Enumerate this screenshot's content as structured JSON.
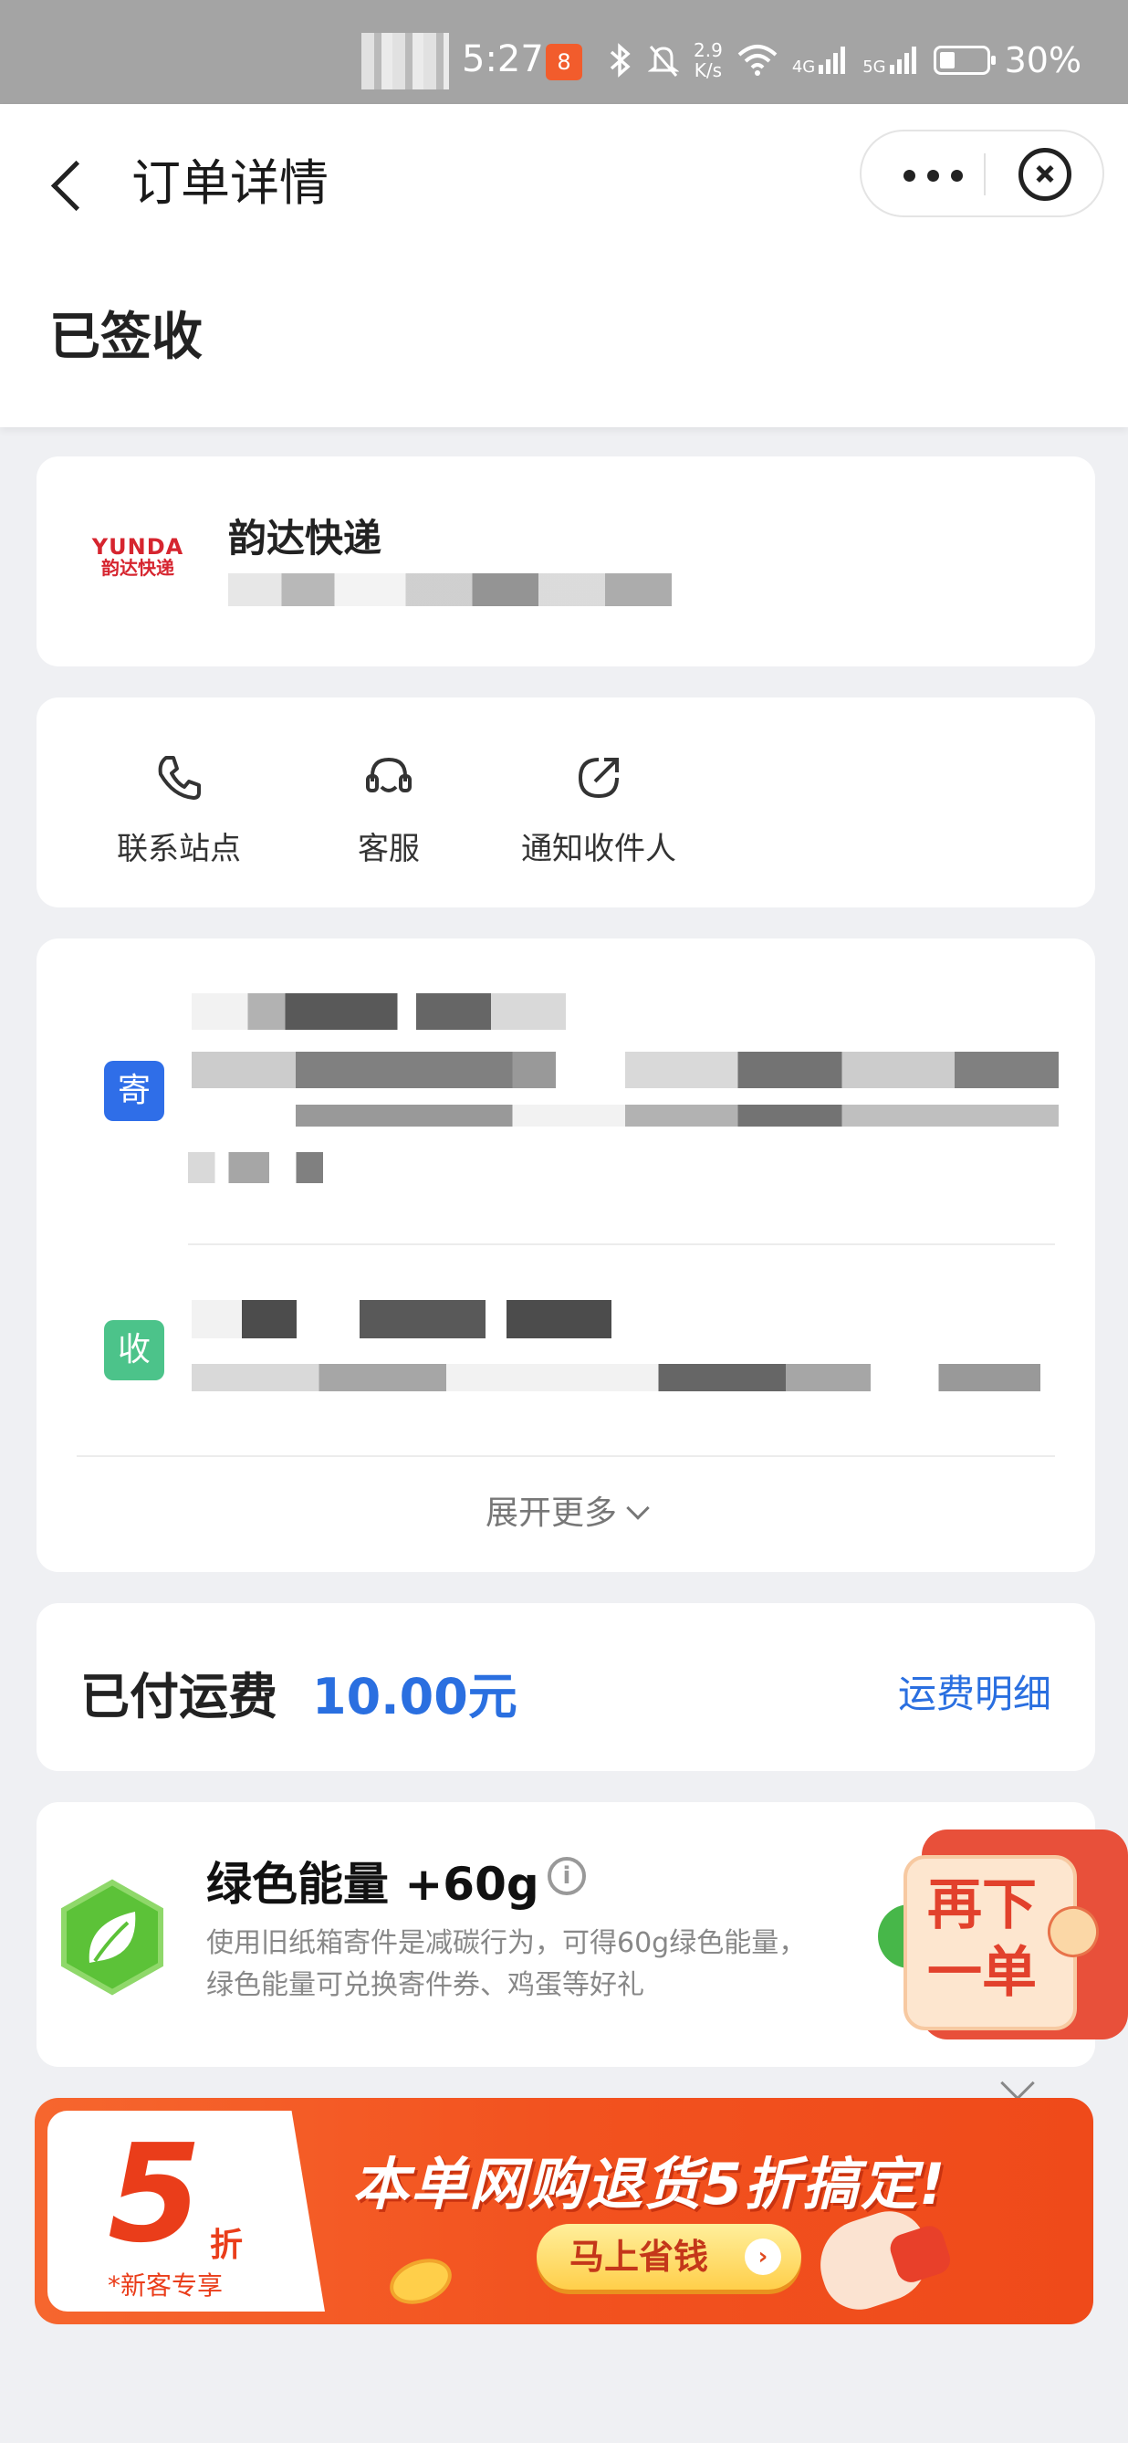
{
  "status_bar": {
    "time": "5:27",
    "app_badge": "8",
    "speed_value": "2.9",
    "speed_unit": "K/s",
    "net_4g": "4G",
    "net_5g": "5G",
    "battery": "30%",
    "icons": [
      "bluetooth-icon",
      "mute-icon",
      "wifi-icon",
      "signal-icon",
      "battery-icon"
    ]
  },
  "header": {
    "title": "订单详情",
    "status": "已签收"
  },
  "courier": {
    "logo_en": "YUNDA",
    "logo_cn": "韵达快递",
    "name": "韵达快递"
  },
  "actions": [
    {
      "label": "联系站点",
      "icon": "phone-icon"
    },
    {
      "label": "客服",
      "icon": "headset-icon"
    },
    {
      "label": "通知收件人",
      "icon": "share-icon"
    }
  ],
  "address": {
    "sender_tag": "寄",
    "receiver_tag": "收",
    "expand_label": "展开更多"
  },
  "fee": {
    "label": "已付运费",
    "value": "10.00元",
    "link": "运费明细"
  },
  "energy": {
    "title": "绿色能量 +60g",
    "info": "i",
    "desc_line1": "使用旧纸箱寄件是减碳行为，可得60g绿色能量，",
    "desc_line2": "绿色能量可兑换寄件券、鸡蛋等好礼"
  },
  "reorder": {
    "line1": "再下",
    "line2": "一单"
  },
  "promo": {
    "big_number": "5",
    "unit": "折",
    "new_user": "*新客专享",
    "headline": "本单网购退货5折搞定!",
    "cta": "马上省钱",
    "cta_arrow": "›"
  },
  "colors": {
    "accent_blue": "#2a6fe0",
    "sender_tag": "#2f6ee8",
    "receiver_tag": "#4cc38a",
    "promo_orange": "#f2521f",
    "yunda_red": "#d6252f"
  }
}
